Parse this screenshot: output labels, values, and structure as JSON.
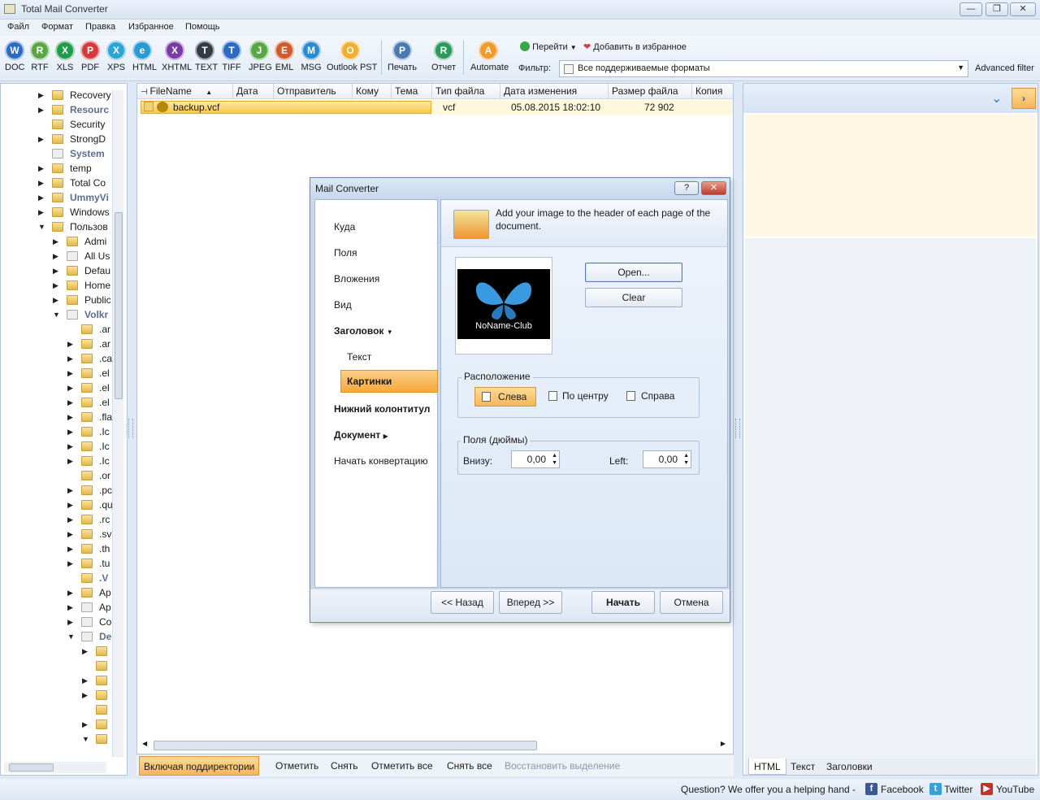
{
  "window": {
    "title": "Total Mail Converter"
  },
  "menu": [
    "Файл",
    "Формат",
    "Правка",
    "Избранное",
    "Помощь"
  ],
  "toolbar": {
    "formats": [
      {
        "label": "DOC",
        "glyph": "W",
        "color": "#2a6cc4"
      },
      {
        "label": "RTF",
        "glyph": "R",
        "color": "#5aa643"
      },
      {
        "label": "XLS",
        "glyph": "X",
        "color": "#1f9b4a"
      },
      {
        "label": "PDF",
        "glyph": "P",
        "color": "#d63b3b"
      },
      {
        "label": "XPS",
        "glyph": "X",
        "color": "#2aa6d6"
      },
      {
        "label": "HTML",
        "glyph": "e",
        "color": "#2a9ad4"
      },
      {
        "label": "XHTML",
        "glyph": "X",
        "color": "#7a3aa6"
      },
      {
        "label": "TEXT",
        "glyph": "T",
        "color": "#333a48"
      },
      {
        "label": "TIFF",
        "glyph": "T",
        "color": "#2a6cc4"
      },
      {
        "label": "JPEG",
        "glyph": "J",
        "color": "#55a844"
      },
      {
        "label": "EML",
        "glyph": "E",
        "color": "#d05a2a"
      },
      {
        "label": "MSG",
        "glyph": "M",
        "color": "#2a8ad4"
      },
      {
        "label": "Outlook PST",
        "glyph": "O",
        "color": "#f0b030"
      },
      {
        "label": "Печать",
        "glyph": "P",
        "color": "#4a7ab4"
      },
      {
        "label": "Отчет",
        "glyph": "R",
        "color": "#2a9a5a"
      },
      {
        "label": "Automate",
        "glyph": "A",
        "color": "#f09a2a"
      }
    ],
    "goto_label": "Перейти",
    "favorites_label": "Добавить в избранное",
    "filter_label": "Фильтр:",
    "filter_value": "Все поддерживаемые форматы",
    "advanced_filter": "Advanced filter"
  },
  "tree": {
    "items": [
      {
        "label": "Recovery",
        "indent": 0,
        "arrow": "▶",
        "bold": false,
        "sys": false
      },
      {
        "label": "Resourc",
        "indent": 0,
        "arrow": "▶",
        "bold": true,
        "sys": false
      },
      {
        "label": "Security",
        "indent": 0,
        "arrow": "",
        "bold": false,
        "sys": false
      },
      {
        "label": "StrongD",
        "indent": 0,
        "arrow": "▶",
        "bold": false,
        "sys": false
      },
      {
        "label": "System",
        "indent": 0,
        "arrow": "",
        "bold": true,
        "sys": true
      },
      {
        "label": "temp",
        "indent": 0,
        "arrow": "▶",
        "bold": false,
        "sys": false
      },
      {
        "label": "Total Co",
        "indent": 0,
        "arrow": "▶",
        "bold": false,
        "sys": false
      },
      {
        "label": "UmmyVi",
        "indent": 0,
        "arrow": "▶",
        "bold": true,
        "sys": false
      },
      {
        "label": "Windows",
        "indent": 0,
        "arrow": "▶",
        "bold": false,
        "sys": false
      },
      {
        "label": "Пользов",
        "indent": 0,
        "arrow": "▼",
        "bold": false,
        "sys": false
      },
      {
        "label": "Admi",
        "indent": 1,
        "arrow": "▶",
        "bold": false,
        "sys": false
      },
      {
        "label": "All Us",
        "indent": 1,
        "arrow": "▶",
        "bold": false,
        "sys": true
      },
      {
        "label": "Defau",
        "indent": 1,
        "arrow": "▶",
        "bold": false,
        "sys": false
      },
      {
        "label": "Home",
        "indent": 1,
        "arrow": "▶",
        "bold": false,
        "sys": false
      },
      {
        "label": "Public",
        "indent": 1,
        "arrow": "▶",
        "bold": false,
        "sys": false
      },
      {
        "label": "Volkr",
        "indent": 1,
        "arrow": "▼",
        "bold": true,
        "sys": true
      },
      {
        "label": ".ar",
        "indent": 2,
        "arrow": "",
        "bold": false,
        "sys": false
      },
      {
        "label": ".ar",
        "indent": 2,
        "arrow": "▶",
        "bold": false,
        "sys": false
      },
      {
        "label": ".ca",
        "indent": 2,
        "arrow": "▶",
        "bold": false,
        "sys": false
      },
      {
        "label": ".el",
        "indent": 2,
        "arrow": "▶",
        "bold": false,
        "sys": false
      },
      {
        "label": ".el",
        "indent": 2,
        "arrow": "▶",
        "bold": false,
        "sys": false
      },
      {
        "label": ".el",
        "indent": 2,
        "arrow": "▶",
        "bold": false,
        "sys": false
      },
      {
        "label": ".fla",
        "indent": 2,
        "arrow": "▶",
        "bold": false,
        "sys": false
      },
      {
        "label": ".Ic",
        "indent": 2,
        "arrow": "▶",
        "bold": false,
        "sys": false
      },
      {
        "label": ".Ic",
        "indent": 2,
        "arrow": "▶",
        "bold": false,
        "sys": false
      },
      {
        "label": ".Ic",
        "indent": 2,
        "arrow": "▶",
        "bold": false,
        "sys": false
      },
      {
        "label": ".or",
        "indent": 2,
        "arrow": "",
        "bold": false,
        "sys": false
      },
      {
        "label": ".pc",
        "indent": 2,
        "arrow": "▶",
        "bold": false,
        "sys": false
      },
      {
        "label": ".qu",
        "indent": 2,
        "arrow": "▶",
        "bold": false,
        "sys": false
      },
      {
        "label": ".rc",
        "indent": 2,
        "arrow": "▶",
        "bold": false,
        "sys": false
      },
      {
        "label": ".sv",
        "indent": 2,
        "arrow": "▶",
        "bold": false,
        "sys": false
      },
      {
        "label": ".th",
        "indent": 2,
        "arrow": "▶",
        "bold": false,
        "sys": false
      },
      {
        "label": ".tu",
        "indent": 2,
        "arrow": "▶",
        "bold": false,
        "sys": false
      },
      {
        "label": ".V",
        "indent": 2,
        "arrow": "",
        "bold": true,
        "sys": false
      },
      {
        "label": "Ap",
        "indent": 2,
        "arrow": "▶",
        "bold": false,
        "sys": false
      },
      {
        "label": "Ap",
        "indent": 2,
        "arrow": "▶",
        "bold": false,
        "sys": true
      },
      {
        "label": "Co",
        "indent": 2,
        "arrow": "▶",
        "bold": false,
        "sys": true
      },
      {
        "label": "De",
        "indent": 2,
        "arrow": "▼",
        "bold": true,
        "sys": true
      },
      {
        "label": "",
        "indent": 3,
        "arrow": "▶",
        "bold": false,
        "sys": false
      },
      {
        "label": "",
        "indent": 3,
        "arrow": "",
        "bold": false,
        "sys": false
      },
      {
        "label": "",
        "indent": 3,
        "arrow": "▶",
        "bold": false,
        "sys": false
      },
      {
        "label": "",
        "indent": 3,
        "arrow": "▶",
        "bold": false,
        "sys": false
      },
      {
        "label": "",
        "indent": 3,
        "arrow": "",
        "bold": false,
        "sys": false
      },
      {
        "label": "",
        "indent": 3,
        "arrow": "▶",
        "bold": false,
        "sys": false
      },
      {
        "label": "",
        "indent": 3,
        "arrow": "▼",
        "bold": false,
        "sys": false
      }
    ]
  },
  "list": {
    "columns": [
      "FileName",
      "Дата",
      "Отправитель",
      "Кому",
      "Тема",
      "Тип файла",
      "Дата изменения",
      "Размер файла",
      "Копия"
    ],
    "rows": [
      {
        "filename": "backup.vcf",
        "type": "vcf",
        "modified": "05.08.2015 18:02:10",
        "size": "72 902"
      }
    ],
    "bottom": {
      "include_subdirs": "Включая поддиректории",
      "mark": "Отметить",
      "unmark": "Снять",
      "mark_all": "Отметить все",
      "unmark_all": "Снять все",
      "restore": "Восстановить выделение"
    }
  },
  "preview": {
    "tabs": [
      "HTML",
      "Текст",
      "Заголовки"
    ]
  },
  "status": {
    "question": "Question? We offer you a helping hand -",
    "facebook": "Facebook",
    "twitter": "Twitter",
    "youtube": "YouTube"
  },
  "dialog": {
    "title": "Mail Converter",
    "help_btn": "?",
    "close_btn": "✕",
    "nav": {
      "where": "Куда",
      "fields": "Поля",
      "attachments": "Вложения",
      "view": "Вид",
      "header": "Заголовок",
      "text": "Текст",
      "pictures": "Картинки",
      "footer": "Нижний колонтитул",
      "document": "Документ",
      "start": "Начать конвертацию"
    },
    "head_text": "Add your image to the header of each page of the document.",
    "image_watermark": "NoName-Club",
    "open_btn": "Open...",
    "clear_btn": "Clear",
    "position": {
      "label": "Расположение",
      "left": "Слева",
      "center": "По центру",
      "right": "Справа"
    },
    "margins": {
      "label": "Поля (дюймы)",
      "bottom_label": "Внизу:",
      "bottom_value": "0,00",
      "left_label": "Left:",
      "left_value": "0,00"
    },
    "footer": {
      "back": "<< Назад",
      "next": "Вперед >>",
      "start": "Начать",
      "cancel": "Отмена"
    }
  }
}
